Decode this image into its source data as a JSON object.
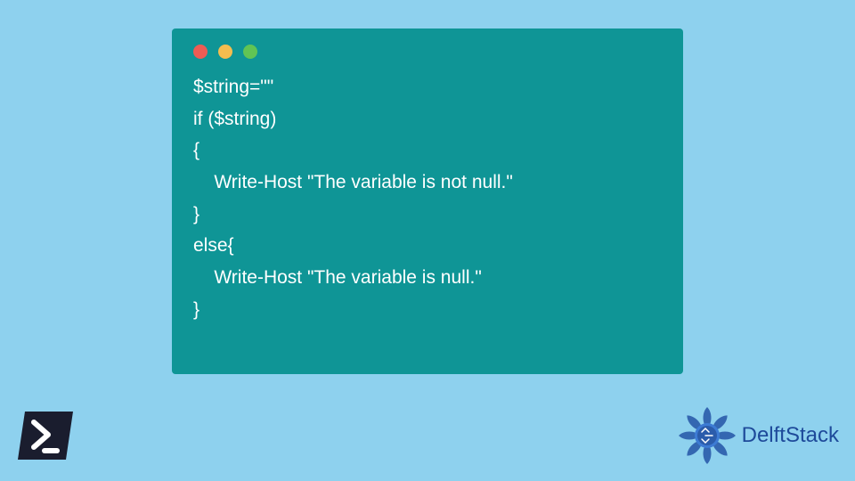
{
  "code": {
    "lines": [
      "$string=\"\"",
      "if ($string)",
      "{",
      "    Write-Host \"The variable is not null.\"",
      "}",
      "else{",
      "    Write-Host \"The variable is null.\"",
      "}"
    ]
  },
  "logo": {
    "text": "DelftStack"
  },
  "icons": {
    "powershell": "powershell-icon",
    "delft": "delft-mandala-icon"
  }
}
